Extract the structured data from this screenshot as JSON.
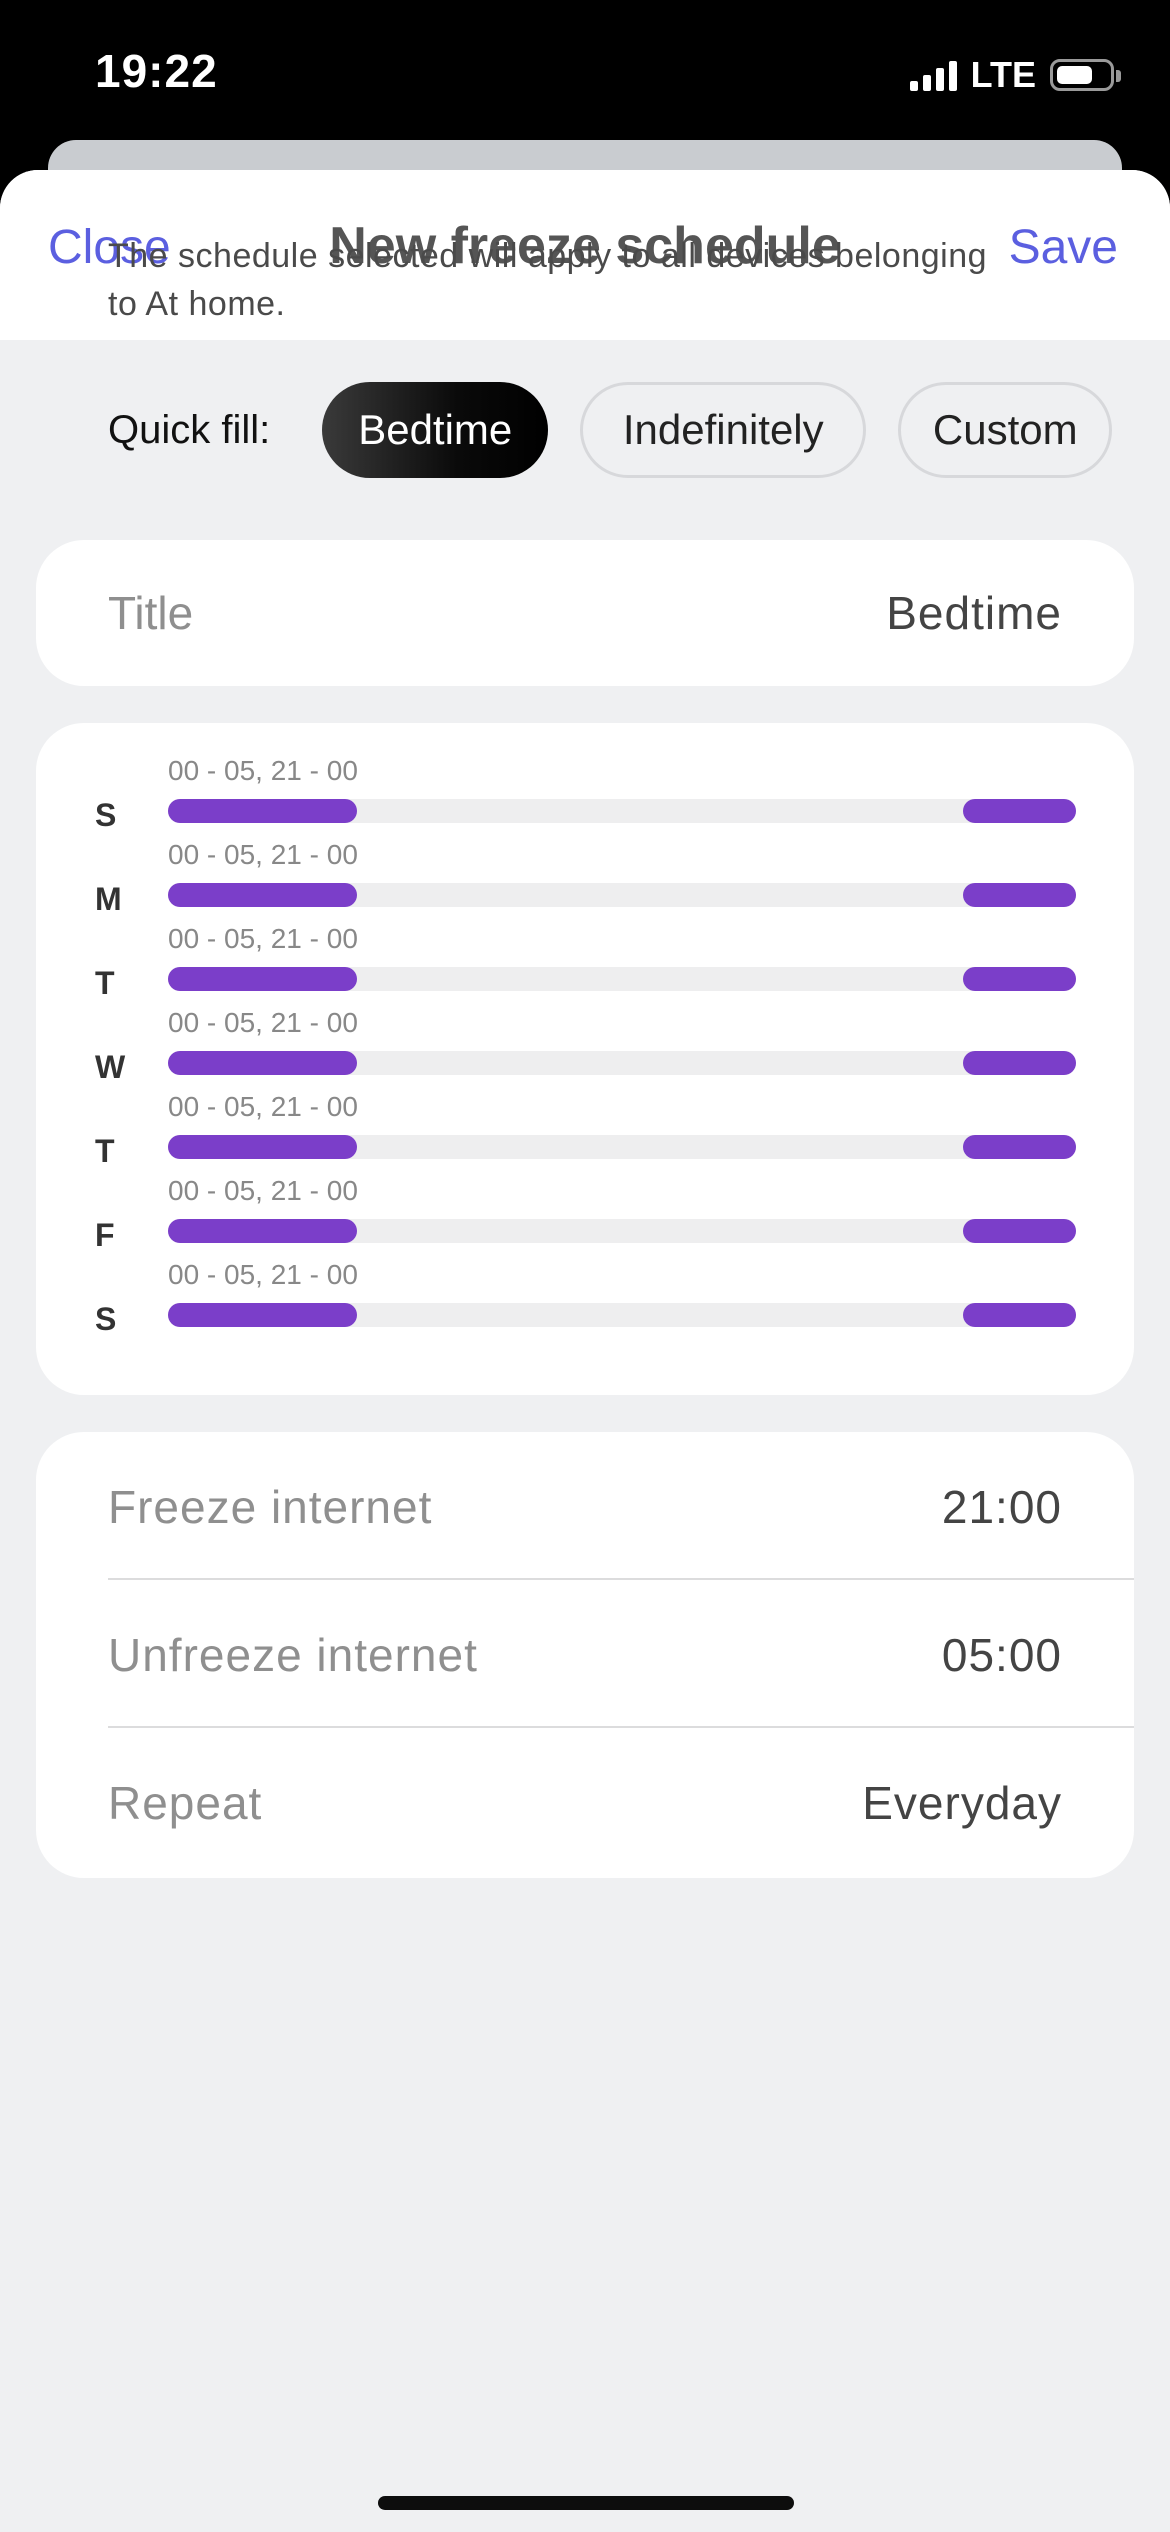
{
  "status_bar": {
    "time": "19:22",
    "network": "LTE",
    "battery_level": 0.7
  },
  "nav": {
    "close_label": "Close",
    "title": "New freeze schedule",
    "save_label": "Save"
  },
  "description": "The schedule selected will apply to all devices belonging to At home.",
  "quick_fill": {
    "label": "Quick fill:",
    "options": [
      {
        "label": "Bedtime",
        "selected": true
      },
      {
        "label": "Indefinitely",
        "selected": false
      },
      {
        "label": "Custom",
        "selected": false
      }
    ]
  },
  "title_field": {
    "label": "Title",
    "value": "Bedtime"
  },
  "schedule": {
    "accent_color": "#7b3ec9",
    "track_color": "#eeeeef",
    "days": [
      {
        "letter": "S",
        "range": "00 - 05, 21 - 00"
      },
      {
        "letter": "M",
        "range": "00 - 05, 21 - 00"
      },
      {
        "letter": "T",
        "range": "00 - 05, 21 - 00"
      },
      {
        "letter": "W",
        "range": "00 - 05, 21 - 00"
      },
      {
        "letter": "T",
        "range": "00 - 05, 21 - 00"
      },
      {
        "letter": "F",
        "range": "00 - 05, 21 - 00"
      },
      {
        "letter": "S",
        "range": "00 - 05, 21 - 00"
      }
    ],
    "frozen_hours": [
      [
        0,
        5
      ],
      [
        21,
        24
      ]
    ]
  },
  "settings": [
    {
      "label": "Freeze internet",
      "value": "21:00"
    },
    {
      "label": "Unfreeze internet",
      "value": "05:00"
    },
    {
      "label": "Repeat",
      "value": "Everyday"
    }
  ],
  "colors": {
    "link": "#5b5fe0",
    "sheet_background": "#eff0f2"
  }
}
